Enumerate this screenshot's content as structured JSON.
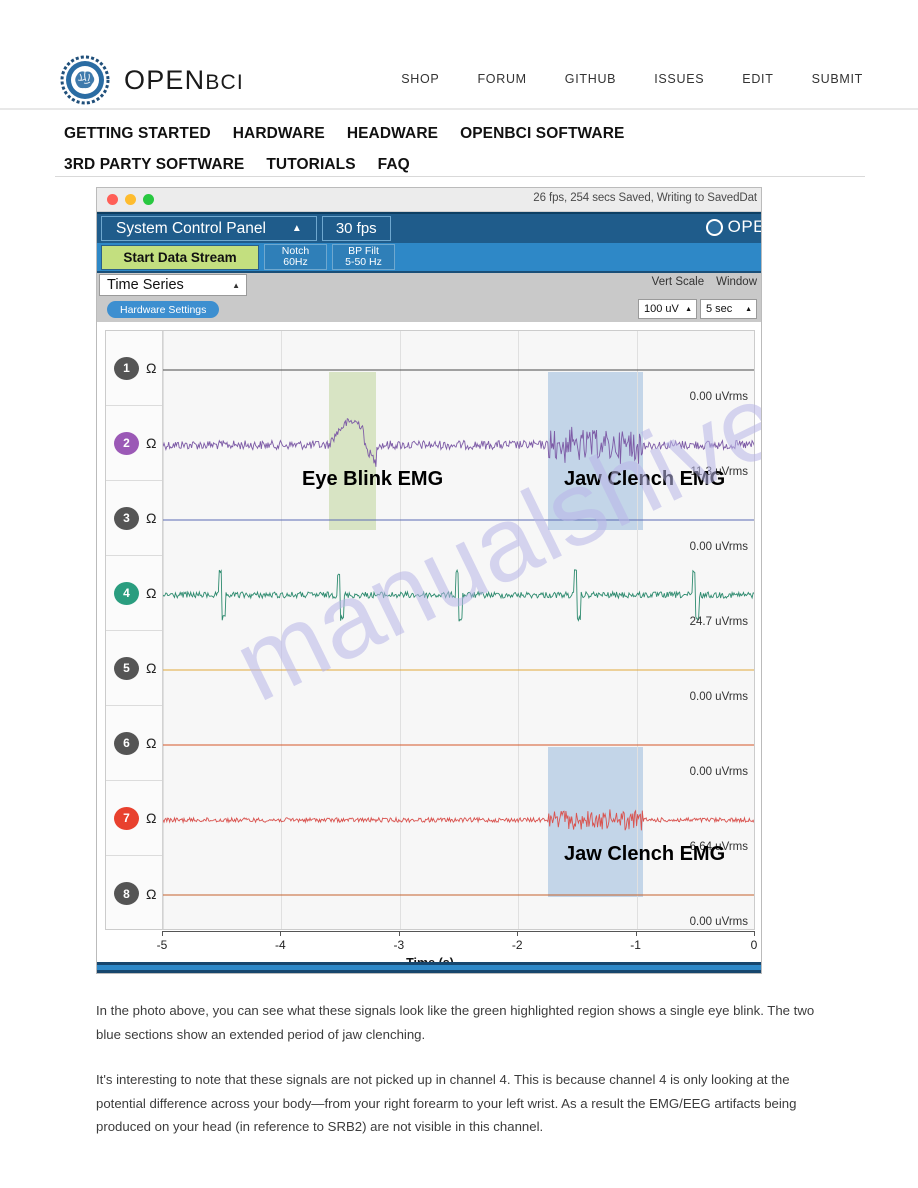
{
  "site": {
    "brand": {
      "name_open": "OPEN",
      "name_bci": "BCI",
      "logo_icon": "openbci-gear-brain-logo"
    },
    "top_nav": [
      {
        "label": "SHOP"
      },
      {
        "label": "FORUM"
      },
      {
        "label": "GITHUB"
      },
      {
        "label": "ISSUES"
      },
      {
        "label": "EDIT"
      },
      {
        "label": "SUBMIT"
      }
    ],
    "main_nav": [
      {
        "label": "GETTING STARTED"
      },
      {
        "label": "HARDWARE"
      },
      {
        "label": "HEADWARE"
      },
      {
        "label": "OPENBCI SOFTWARE"
      },
      {
        "label": "3RD PARTY SOFTWARE"
      },
      {
        "label": "TUTORIALS"
      },
      {
        "label": "FAQ"
      }
    ]
  },
  "gui": {
    "titlebar": {
      "status": "26 fps, 254 secs Saved, Writing to SavedDat",
      "close_icon": "traffic-light-close",
      "minimize_icon": "traffic-light-minimize",
      "zoom_icon": "traffic-light-zoom"
    },
    "control_bar": {
      "system_control_panel": "System Control Panel",
      "collapse_icon": "triangle-up-icon",
      "fps": "30 fps",
      "brand": "OPE"
    },
    "toolbar": {
      "start_data_stream": "Start Data Stream",
      "notch_line1": "Notch",
      "notch_line2": "60Hz",
      "bpfilt_line1": "BP Filt",
      "bpfilt_line2": "5-50 Hz"
    },
    "widget_bar": {
      "widget_name": "Time Series",
      "widget_caret_icon": "caret-up-icon",
      "hardware_settings": "Hardware Settings",
      "vert_scale_label": "Vert Scale",
      "window_label": "Window",
      "vert_scale_value": "100 uV",
      "window_value": "5 sec"
    },
    "watermark": "manualshive.com"
  },
  "chart_data": {
    "type": "line",
    "title": "Time Series",
    "xlabel": "Time (s)",
    "ylabel": "",
    "xlim": [
      -5,
      0
    ],
    "x_ticks": [
      -5,
      -4,
      -3,
      -2,
      -1,
      0
    ],
    "x_tick_labels": [
      "-5",
      "-4",
      "-3",
      "-2",
      "-1",
      "0"
    ],
    "grid": true,
    "vert_scale": "100 uV",
    "window": "5 sec",
    "channels": [
      {
        "number": "1",
        "impedance_icon": "ohm-symbol",
        "rms": "0.00 uVrms",
        "color": "#4a4a4a",
        "badge_color": "#555555",
        "active": false
      },
      {
        "number": "2",
        "impedance_icon": "ohm-symbol",
        "rms": "11.3 uVrms",
        "color": "#7d5ba6",
        "badge_color": "#9b59b6",
        "active": true
      },
      {
        "number": "3",
        "impedance_icon": "ohm-symbol",
        "rms": "0.00 uVrms",
        "color": "#5b6bb5",
        "badge_color": "#555555",
        "active": false
      },
      {
        "number": "4",
        "impedance_icon": "ohm-symbol",
        "rms": "24.7 uVrms",
        "color": "#2e8b6f",
        "badge_color": "#2a9d7f",
        "active": true
      },
      {
        "number": "5",
        "impedance_icon": "ohm-symbol",
        "rms": "0.00 uVrms",
        "color": "#e0a93b",
        "badge_color": "#555555",
        "active": false
      },
      {
        "number": "6",
        "impedance_icon": "ohm-symbol",
        "rms": "0.00 uVrms",
        "color": "#d4572a",
        "badge_color": "#555555",
        "active": false
      },
      {
        "number": "7",
        "impedance_icon": "ohm-symbol",
        "rms": "6.64 uVrms",
        "color": "#d9534f",
        "badge_color": "#e8412e",
        "active": true
      },
      {
        "number": "8",
        "impedance_icon": "ohm-symbol",
        "rms": "0.00 uVrms",
        "color": "#c4622d",
        "badge_color": "#555555",
        "active": false
      }
    ],
    "annotations": [
      {
        "text": "Eye Blink EMG",
        "region": "green",
        "channel": 2
      },
      {
        "text": "Jaw Clench EMG",
        "region": "blue",
        "channel": 2
      },
      {
        "text": "Jaw Clench EMG",
        "region": "blue",
        "channel": 7
      }
    ],
    "highlight_regions": [
      {
        "label": "Eye Blink EMG",
        "color": "#d8e4c4",
        "x_start": -3.6,
        "x_end": -3.2
      },
      {
        "label": "Jaw Clench EMG",
        "color": "#c3d5e8",
        "x_start": -1.75,
        "x_end": -0.95
      }
    ]
  },
  "prose": {
    "p1": "In the photo above, you can see what these signals look like the green highlighted region shows a single eye blink. The two blue sections show an extended period of jaw clenching.",
    "p2": "It's interesting to note that these signals are not picked up in channel 4. This is because channel 4 is only looking at the potential difference across your body—from your right forearm to your left wrist. As a result the EMG/EEG artifacts being produced on your head (in reference to SRB2) are not visible in this channel."
  }
}
